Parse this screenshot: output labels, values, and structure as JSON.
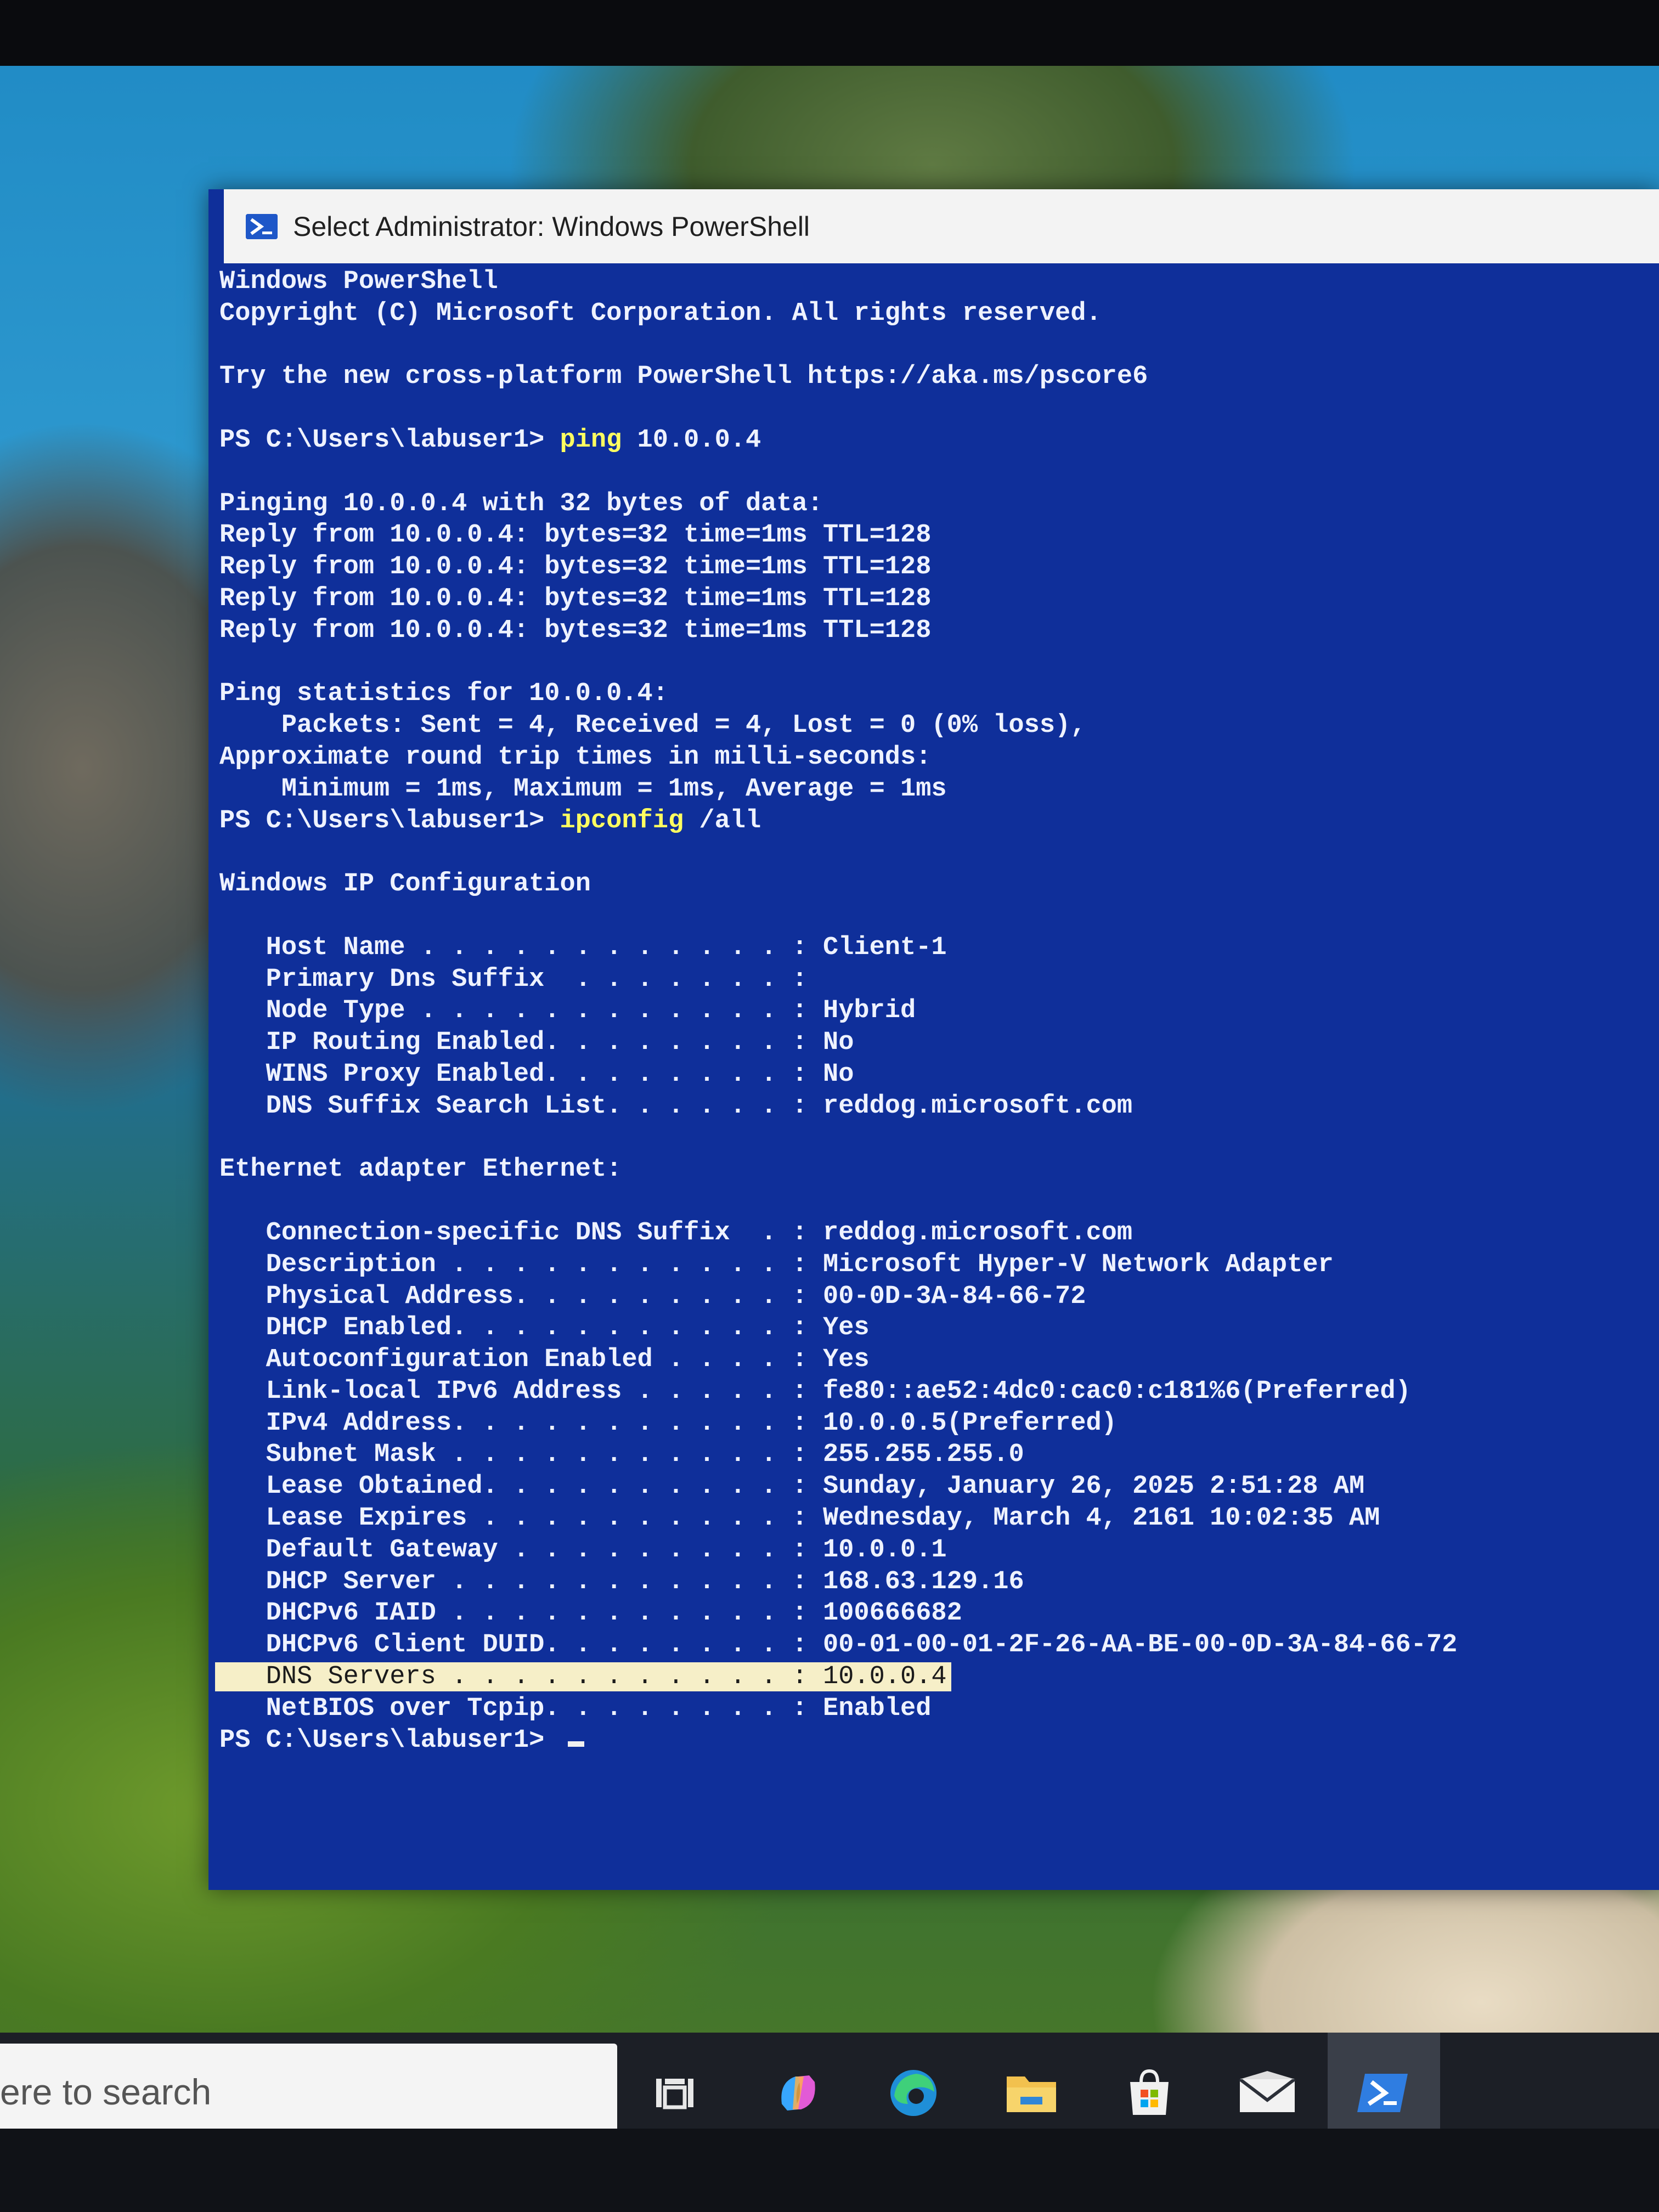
{
  "window": {
    "title": "Select Administrator: Windows PowerShell",
    "icon": "powershell-icon"
  },
  "console": {
    "banner": [
      "Windows PowerShell",
      "Copyright (C) Microsoft Corporation. All rights reserved.",
      "",
      "Try the new cross-platform PowerShell https://aka.ms/pscore6",
      ""
    ],
    "prompt": "PS C:\\Users\\labuser1> ",
    "command1": {
      "name": "ping",
      "args": " 10.0.0.4"
    },
    "ping_output": [
      "",
      "Pinging 10.0.0.4 with 32 bytes of data:",
      "Reply from 10.0.0.4: bytes=32 time=1ms TTL=128",
      "Reply from 10.0.0.4: bytes=32 time=1ms TTL=128",
      "Reply from 10.0.0.4: bytes=32 time=1ms TTL=128",
      "Reply from 10.0.0.4: bytes=32 time=1ms TTL=128",
      "",
      "Ping statistics for 10.0.0.4:",
      "    Packets: Sent = 4, Received = 4, Lost = 0 (0% loss),",
      "Approximate round trip times in milli-seconds:",
      "    Minimum = 1ms, Maximum = 1ms, Average = 1ms"
    ],
    "command2": {
      "name": "ipconfig",
      "args": " /all"
    },
    "ipconfig_header": "Windows IP Configuration",
    "ip_config": [
      {
        "key": "   Host Name . . . . . . . . . . . . : ",
        "value": "Client-1"
      },
      {
        "key": "   Primary Dns Suffix  . . . . . . . : ",
        "value": ""
      },
      {
        "key": "   Node Type . . . . . . . . . . . . : ",
        "value": "Hybrid"
      },
      {
        "key": "   IP Routing Enabled. . . . . . . . : ",
        "value": "No"
      },
      {
        "key": "   WINS Proxy Enabled. . . . . . . . : ",
        "value": "No"
      },
      {
        "key": "   DNS Suffix Search List. . . . . . : ",
        "value": "reddog.microsoft.com"
      }
    ],
    "adapter_header": "Ethernet adapter Ethernet:",
    "adapter": [
      {
        "key": "   Connection-specific DNS Suffix  . : ",
        "value": "reddog.microsoft.com"
      },
      {
        "key": "   Description . . . . . . . . . . . : ",
        "value": "Microsoft Hyper-V Network Adapter"
      },
      {
        "key": "   Physical Address. . . . . . . . . : ",
        "value": "00-0D-3A-84-66-72"
      },
      {
        "key": "   DHCP Enabled. . . . . . . . . . . : ",
        "value": "Yes"
      },
      {
        "key": "   Autoconfiguration Enabled . . . . : ",
        "value": "Yes"
      },
      {
        "key": "   Link-local IPv6 Address . . . . . : ",
        "value": "fe80::ae52:4dc0:cac0:c181%6(Preferred)"
      },
      {
        "key": "   IPv4 Address. . . . . . . . . . . : ",
        "value": "10.0.0.5(Preferred)"
      },
      {
        "key": "   Subnet Mask . . . . . . . . . . . : ",
        "value": "255.255.255.0"
      },
      {
        "key": "   Lease Obtained. . . . . . . . . . : ",
        "value": "Sunday, January 26, 2025 2:51:28 AM"
      },
      {
        "key": "   Lease Expires . . . . . . . . . . : ",
        "value": "Wednesday, March 4, 2161 10:02:35 AM"
      },
      {
        "key": "   Default Gateway . . . . . . . . . : ",
        "value": "10.0.0.1"
      },
      {
        "key": "   DHCP Server . . . . . . . . . . . : ",
        "value": "168.63.129.16"
      },
      {
        "key": "   DHCPv6 IAID . . . . . . . . . . . : ",
        "value": "100666682"
      },
      {
        "key": "   DHCPv6 Client DUID. . . . . . . . : ",
        "value": "00-01-00-01-2F-26-AA-BE-00-0D-3A-84-66-72"
      },
      {
        "key": "   DNS Servers . . . . . . . . . . . : ",
        "value": "10.0.0.4",
        "highlighted": true
      },
      {
        "key": "   NetBIOS over Tcpip. . . . . . . . : ",
        "value": "Enabled"
      }
    ],
    "final_prompt": "PS C:\\Users\\labuser1> "
  },
  "taskbar": {
    "search_placeholder": "ere to search",
    "icons": [
      "task-view-icon",
      "copilot-icon",
      "edge-icon",
      "file-explorer-icon",
      "microsoft-store-icon",
      "mail-icon",
      "powershell-icon"
    ],
    "active_app": "powershell-icon"
  },
  "colors": {
    "console_bg": "#0f2f9a",
    "console_text": "#eef2ff",
    "command_text": "#ffff60",
    "highlight_bg": "#f6efc8"
  }
}
